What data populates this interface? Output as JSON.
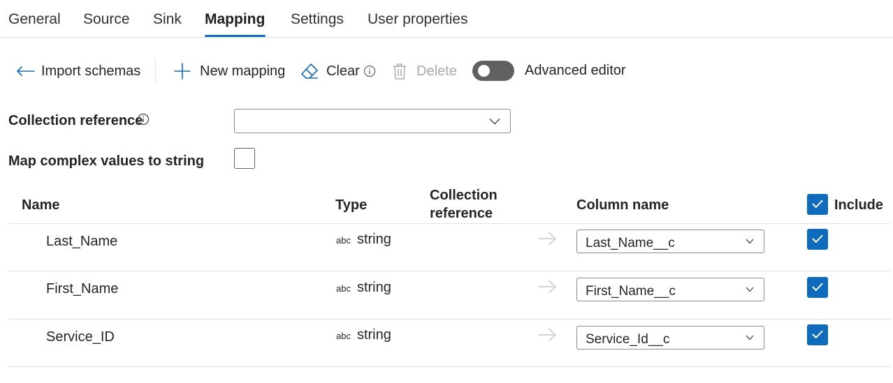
{
  "tabs": [
    {
      "label": "General",
      "active": false
    },
    {
      "label": "Source",
      "active": false
    },
    {
      "label": "Sink",
      "active": false
    },
    {
      "label": "Mapping",
      "active": true
    },
    {
      "label": "Settings",
      "active": false
    },
    {
      "label": "User properties",
      "active": false
    }
  ],
  "toolbar": {
    "import_label": "Import schemas",
    "new_mapping_label": "New mapping",
    "clear_label": "Clear",
    "delete_label": "Delete",
    "advanced_editor_label": "Advanced editor",
    "advanced_editor_on": false
  },
  "form": {
    "collection_reference_label": "Collection reference",
    "collection_reference_value": "",
    "map_complex_label": "Map complex values to string",
    "map_complex_checked": false
  },
  "table": {
    "headers": {
      "name": "Name",
      "type": "Type",
      "collection_ref_line1": "Collection",
      "collection_ref_line2": "reference",
      "column_name": "Column name",
      "include": "Include"
    },
    "include_all_checked": true,
    "rows": [
      {
        "name": "Last_Name",
        "type_abbr": "abc",
        "type": "string",
        "column_name": "Last_Name__c",
        "include": true
      },
      {
        "name": "First_Name",
        "type_abbr": "abc",
        "type": "string",
        "column_name": "First_Name__c",
        "include": true
      },
      {
        "name": "Service_ID",
        "type_abbr": "abc",
        "type": "string",
        "column_name": "Service_Id__c",
        "include": true
      }
    ]
  },
  "colors": {
    "accent": "#0f6cbd",
    "toggle_off": "#616161",
    "divider": "#e1e1e1"
  }
}
